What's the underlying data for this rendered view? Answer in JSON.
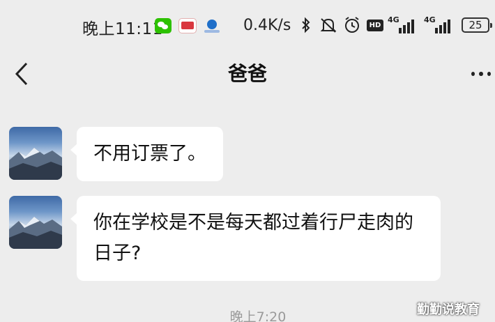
{
  "status_bar": {
    "time": "晚上11:11",
    "net_speed": "0.4K/s",
    "network_label_1": "4G",
    "network_label_2": "4G",
    "hd_label": "HD",
    "battery": "25",
    "icons": [
      "wechat-icon",
      "news-app-icon",
      "bank-app-icon",
      "bluetooth-icon",
      "mute-icon",
      "alarm-icon",
      "hd-badge",
      "signal-icon",
      "signal-icon",
      "battery-icon"
    ]
  },
  "header": {
    "title": "爸爸",
    "back_icon": "chevron-left-icon",
    "more_icon": "more-dots-icon"
  },
  "messages": [
    {
      "sender": "avatar-landscape",
      "text": "不用订票了。"
    },
    {
      "sender": "avatar-landscape",
      "text": "你在学校是不是每天都过着行尸走肉的日子?"
    }
  ],
  "timestamp": "晚上7:20",
  "watermark": "勤勤说教育",
  "colors": {
    "background": "#ededed",
    "bubble": "#ffffff",
    "timestamp": "#9a9a9a",
    "wechat_green": "#2dc100"
  }
}
